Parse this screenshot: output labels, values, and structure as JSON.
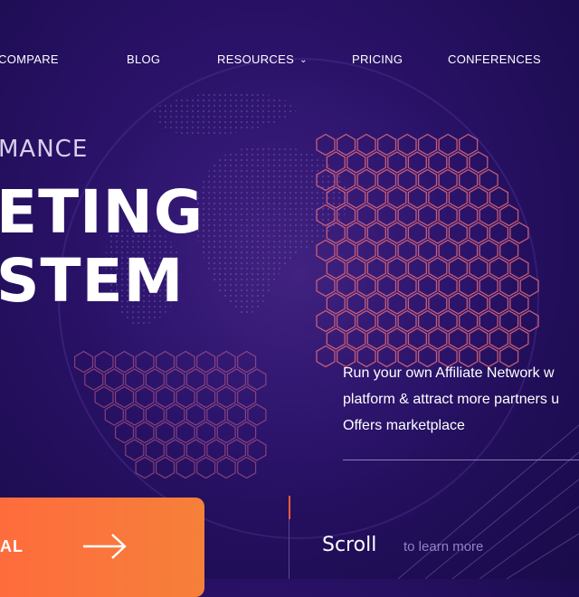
{
  "nav": {
    "items": [
      {
        "label": "COMPARE"
      },
      {
        "label": "BLOG"
      },
      {
        "label": "RESOURCES"
      },
      {
        "label": "PRICING"
      },
      {
        "label": "CONFERENCES"
      }
    ],
    "resources_chevron": "⌄"
  },
  "hero": {
    "kicker": "MANCE",
    "line1": "ETING",
    "line2": "STEM"
  },
  "description": {
    "line1": "Run your own Affiliate Network w",
    "line2": "platform & attract more partners u",
    "line3": "Offers marketplace"
  },
  "cta": {
    "label": "AL",
    "icon": "arrow-right-icon"
  },
  "scroll": {
    "label": "Scroll",
    "sub": "to learn more"
  },
  "colors": {
    "background": "#24105f",
    "accent": "#f5803a",
    "hex_outline": "#ff6a6a"
  }
}
